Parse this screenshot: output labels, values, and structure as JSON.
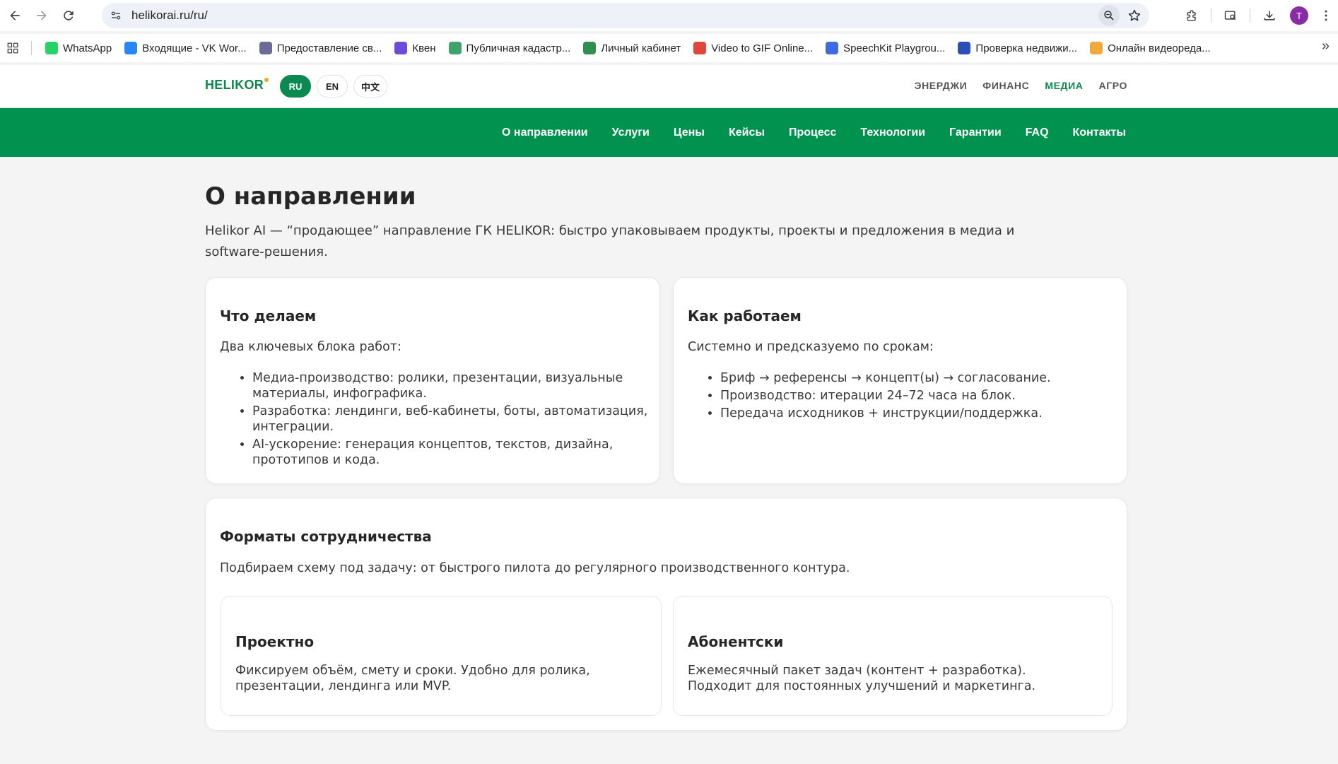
{
  "browser": {
    "url": "helikorai.ru/ru/",
    "avatar_letter": "T"
  },
  "bookmarks": [
    {
      "label": "WhatsApp",
      "color": "#25d366"
    },
    {
      "label": "Входящие - VK Wor...",
      "color": "#2787f5"
    },
    {
      "label": "Предоставление св...",
      "color": "#6b6b9a"
    },
    {
      "label": "Квен",
      "color": "#6e4ad9"
    },
    {
      "label": "Публичная кадастр...",
      "color": "#3fa36b"
    },
    {
      "label": "Личный кабинет",
      "color": "#2f8f4f"
    },
    {
      "label": "Video to GIF Online...",
      "color": "#e0463a"
    },
    {
      "label": "SpeechKit Playgrou...",
      "color": "#3d6be0"
    },
    {
      "label": "Проверка недвижи...",
      "color": "#2a4fb8"
    },
    {
      "label": "Онлайн видеореда...",
      "color": "#f2a93b"
    }
  ],
  "header": {
    "logo": "HELIKOR",
    "languages": [
      "RU",
      "EN",
      "中文"
    ],
    "active_language": "RU",
    "directions": [
      "ЭНЕРДЖИ",
      "ФИНАНС",
      "МЕДИА",
      "АГРО"
    ],
    "active_direction": "МЕДИА"
  },
  "nav": [
    "О направлении",
    "Услуги",
    "Цены",
    "Кейсы",
    "Процесс",
    "Технологии",
    "Гарантии",
    "FAQ",
    "Контакты"
  ],
  "main": {
    "title": "О направлении",
    "lead": "Helikor AI — “продающее” направление ГК HELIKOR: быстро упаковываем продукты, проекты и предложения в медиа и software-решения.",
    "what": {
      "title": "Что делаем",
      "intro": "Два ключевых блока работ:",
      "items": [
        "Медиа-производство: ролики, презентации, визуальные материалы, инфографика.",
        "Разработка: лендинги, веб-кабинеты, боты, автоматизация, интеграции.",
        "AI-ускорение: генерация концептов, текстов, дизайна, прототипов и кода."
      ]
    },
    "how": {
      "title": "Как работаем",
      "intro": "Системно и предсказуемо по срокам:",
      "items": [
        "Бриф → референсы → концепт(ы) → согласование.",
        "Производство: итерации 24–72 часа на блок.",
        "Передача исходников + инструкции/поддержка."
      ]
    },
    "formats": {
      "title": "Форматы сотрудничества",
      "intro": "Подбираем схему под задачу: от быстрого пилота до регулярного производственного контура.",
      "project": {
        "title": "Проектно",
        "text": "Фиксируем объём, смету и сроки. Удобно для ролика, презентации, лендинга или MVP."
      },
      "subscription": {
        "title": "Абонентски",
        "text": "Ежемесячный пакет задач (контент + разработка). Подходит для постоянных улучшений и маркетинга."
      }
    }
  }
}
